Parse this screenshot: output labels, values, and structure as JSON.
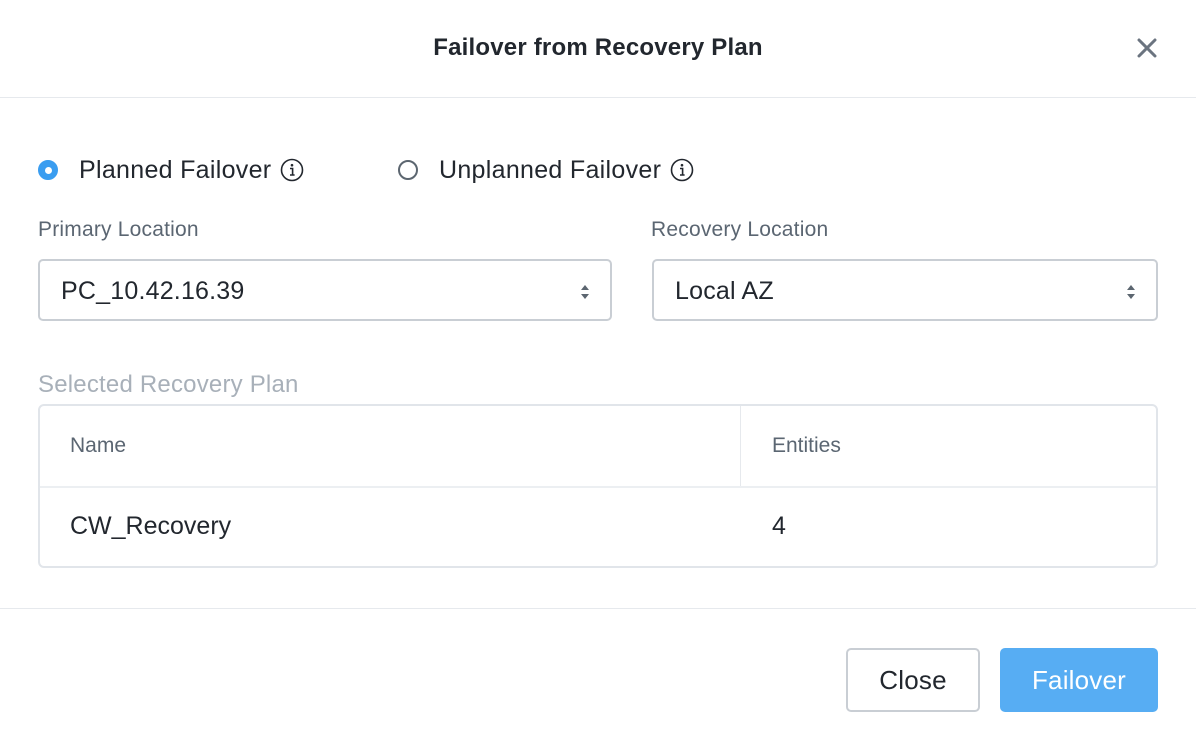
{
  "dialog": {
    "title": "Failover from Recovery Plan",
    "close_icon": "close-icon"
  },
  "failover_type": {
    "options": [
      {
        "label": "Planned Failover",
        "selected": true,
        "icon": "info-icon"
      },
      {
        "label": "Unplanned Failover",
        "selected": false,
        "icon": "info-icon"
      }
    ]
  },
  "primary_location": {
    "label": "Primary Location",
    "value": "PC_10.42.16.39"
  },
  "recovery_location": {
    "label": "Recovery Location",
    "value": "Local AZ"
  },
  "recovery_plan": {
    "section_label": "Selected Recovery Plan",
    "columns": [
      "Name",
      "Entities"
    ],
    "rows": [
      {
        "name": "CW_Recovery",
        "entities": "4"
      }
    ]
  },
  "footer": {
    "close_label": "Close",
    "failover_label": "Failover"
  },
  "colors": {
    "accent": "#3a9df0",
    "primary_button": "#57adf3"
  }
}
